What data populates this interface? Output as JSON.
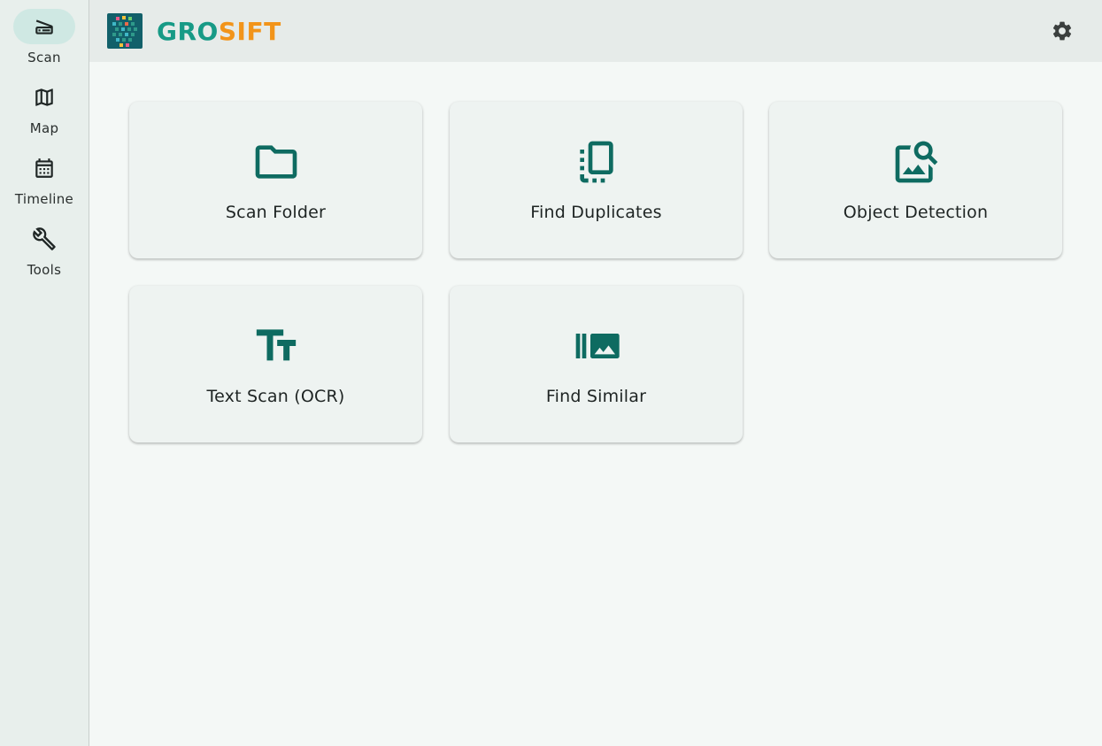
{
  "nav": {
    "items": [
      {
        "label": "Scan",
        "icon": "scanner-icon",
        "active": true
      },
      {
        "label": "Map",
        "icon": "map-icon",
        "active": false
      },
      {
        "label": "Timeline",
        "icon": "calendar-icon",
        "active": false
      },
      {
        "label": "Tools",
        "icon": "wrench-icon",
        "active": false
      }
    ]
  },
  "header": {
    "brand_part1": "GRO",
    "brand_part2": "SIFT",
    "settings_icon": "gear-icon"
  },
  "cards": [
    {
      "label": "Scan Folder",
      "icon": "folder-icon"
    },
    {
      "label": "Find Duplicates",
      "icon": "duplicate-icon"
    },
    {
      "label": "Object Detection",
      "icon": "image-search-icon"
    },
    {
      "label": "Text Scan (OCR)",
      "icon": "text-fields-icon"
    },
    {
      "label": "Find Similar",
      "icon": "image-collection-icon"
    }
  ],
  "colors": {
    "accent": "#0e6b61",
    "brand_teal": "#179a86",
    "brand_orange": "#f2941a",
    "active_nav_bg": "#cfe8e3"
  }
}
